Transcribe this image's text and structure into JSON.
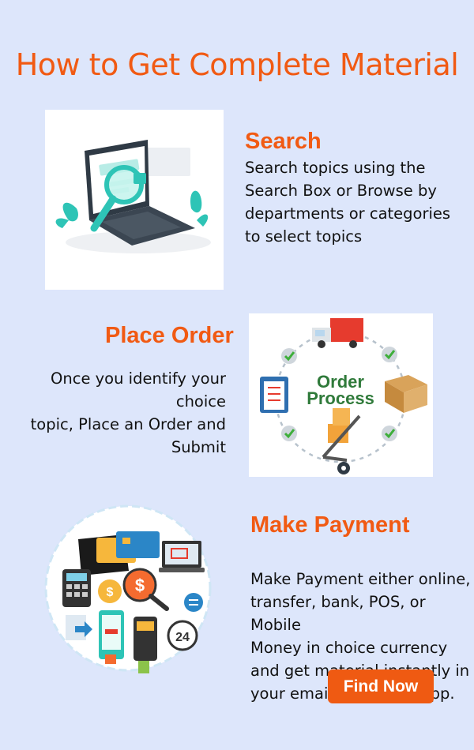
{
  "page": {
    "title": "How to Get Complete Material"
  },
  "steps": [
    {
      "heading": "Search",
      "lines": [
        "Search topics using the",
        "Search Box or Browse by",
        "departments or categories",
        "to select topics"
      ],
      "illustration": "laptop-magnifier-icon"
    },
    {
      "heading": "Place Order",
      "lines": [
        "Once you identify your choice",
        "topic, Place an Order and",
        "Submit"
      ],
      "illustration": "order-process-icon",
      "illustration_text": [
        "Order",
        "Process"
      ]
    },
    {
      "heading": "Make Payment",
      "lines": [
        "Make Payment either online,",
        "transfer, bank, POS, or Mobile",
        "Money in choice currency",
        "and get material instantly in",
        "your email and WhatsApp."
      ],
      "illustration": "payment-methods-icon",
      "illustration_text": [
        "24"
      ]
    }
  ],
  "cta": {
    "label": "Find Now"
  },
  "colors": {
    "accent": "#f15a13",
    "background": "#dde6fb",
    "button": "#ef5a12"
  }
}
